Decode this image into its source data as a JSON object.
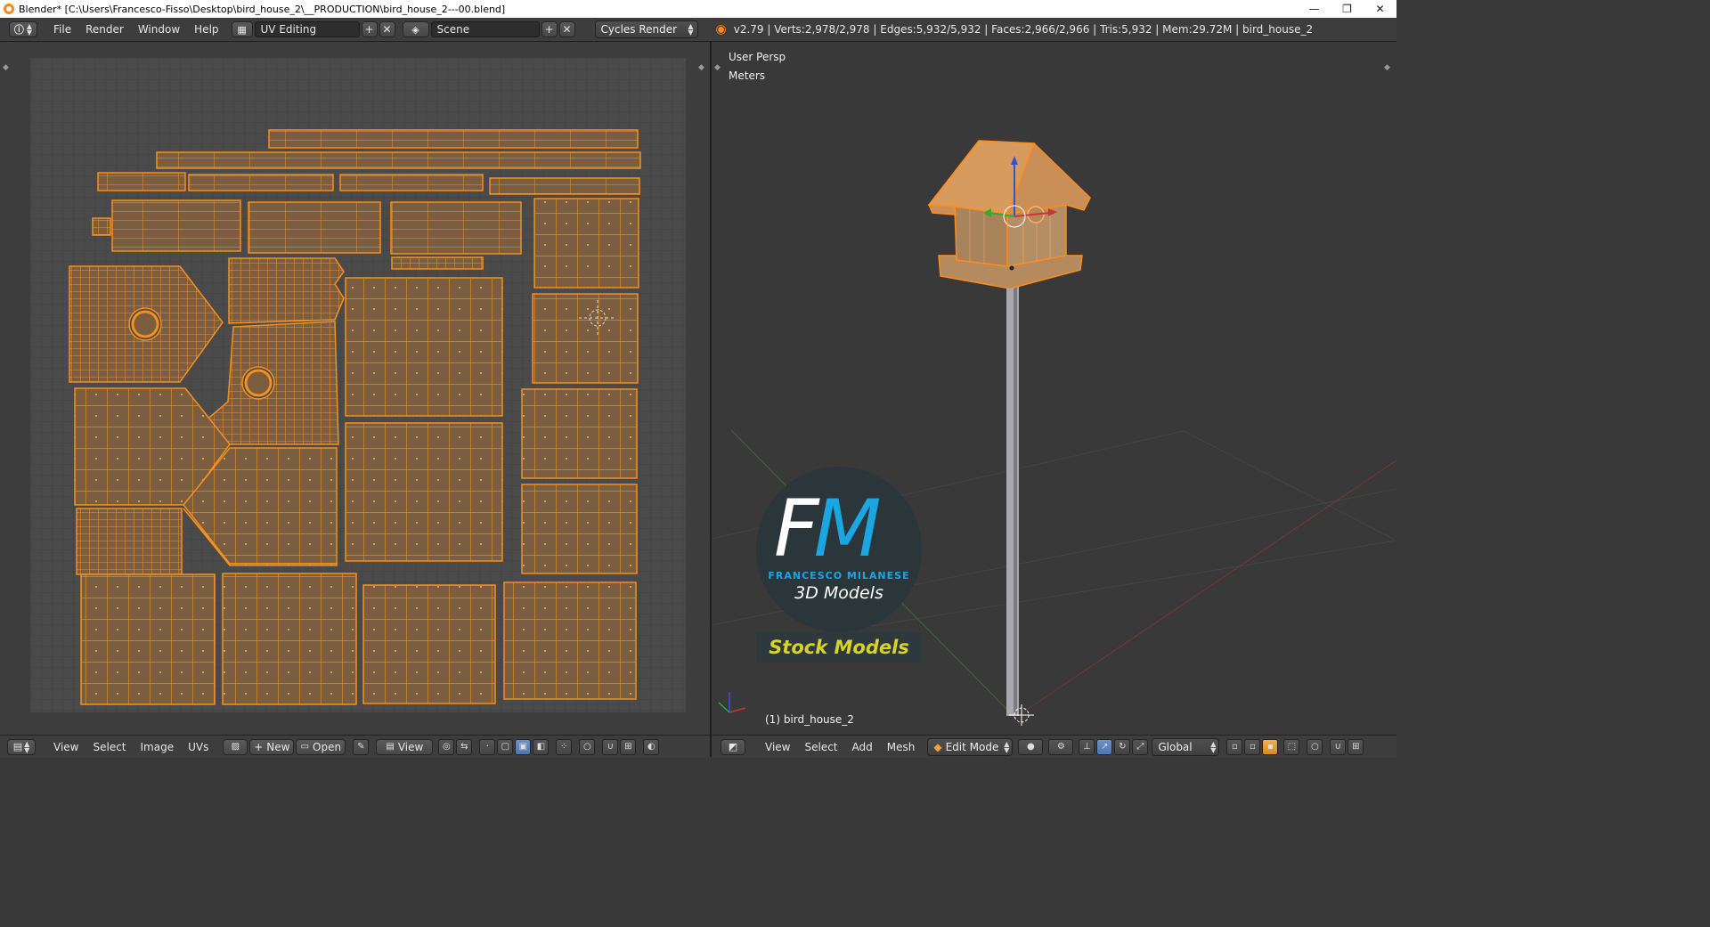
{
  "window": {
    "title": "Blender* [C:\\Users\\Francesco-Fisso\\Desktop\\bird_house_2\\__PRODUCTION\\bird_house_2---00.blend]",
    "controls": [
      "—",
      "❐",
      "✕"
    ]
  },
  "info_header": {
    "menus": [
      "File",
      "Render",
      "Window",
      "Help"
    ],
    "screen_layout": "UV Editing",
    "scene": "Scene",
    "render_engine": "Cycles Render",
    "stats": "v2.79 | Verts:2,978/2,978 | Edges:5,932/5,932 | Faces:2,966/2,966 | Tris:5,932 | Mem:29.72M | bird_house_2"
  },
  "viewport": {
    "view_name": "User Persp",
    "units": "Meters",
    "object_label": "(1) bird_house_2"
  },
  "logo": {
    "mark_f": "F",
    "mark_m": "M",
    "line1": "FRANCESCO MILANESE",
    "line2": "3D Models",
    "band": "Stock Models"
  },
  "uv_header": {
    "menus": [
      "View",
      "Select",
      "Image",
      "UVs"
    ],
    "new_label": "New",
    "open_label": "Open",
    "view_label": "View"
  },
  "viewport_header": {
    "menus": [
      "View",
      "Select",
      "Add",
      "Mesh"
    ],
    "mode": "Edit Mode",
    "orientation": "Global"
  },
  "colors": {
    "uv_fill": "#7b5d40",
    "uv_edge": "#f5901e",
    "selection": "#ff8c1a",
    "axis_x": "#cc3333",
    "axis_y": "#33aa33",
    "axis_z": "#3355cc"
  }
}
